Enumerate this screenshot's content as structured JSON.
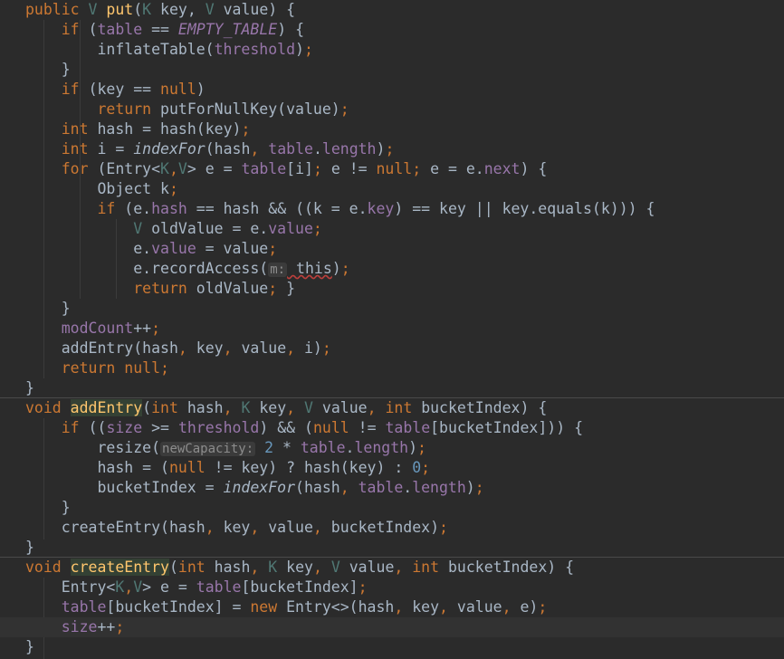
{
  "editor": {
    "lines": [
      [
        [
          "kw",
          "public "
        ],
        [
          "tp",
          "V "
        ],
        [
          "fn",
          "put"
        ],
        [
          "",
          "("
        ],
        [
          "tp",
          "K "
        ],
        [
          "",
          "key, "
        ],
        [
          "tp",
          "V "
        ],
        [
          "",
          "value) {"
        ]
      ],
      [
        [
          "",
          "    "
        ],
        [
          "kw",
          "if "
        ],
        [
          "",
          "("
        ],
        [
          "fld",
          "table"
        ],
        [
          "",
          " == "
        ],
        [
          "cst",
          "EMPTY_TABLE"
        ],
        [
          "",
          ") {"
        ]
      ],
      [
        [
          "",
          "        inflateTable("
        ],
        [
          "fld",
          "threshold"
        ],
        [
          "",
          ")"
        ],
        [
          "kw",
          ";"
        ]
      ],
      [
        [
          "",
          "    }"
        ]
      ],
      [
        [
          "",
          "    "
        ],
        [
          "kw",
          "if "
        ],
        [
          "",
          "(key == "
        ],
        [
          "kw",
          "null"
        ],
        [
          "",
          ")"
        ]
      ],
      [
        [
          "",
          "        "
        ],
        [
          "kw",
          "return "
        ],
        [
          "",
          "putForNullKey(value)"
        ],
        [
          "kw",
          ";"
        ]
      ],
      [
        [
          "",
          "    "
        ],
        [
          "kw",
          "int "
        ],
        [
          "",
          "hash = hash(key)"
        ],
        [
          "kw",
          ";"
        ]
      ],
      [
        [
          "",
          "    "
        ],
        [
          "kw",
          "int "
        ],
        [
          "",
          "i = "
        ],
        [
          "it",
          "indexFor"
        ],
        [
          "",
          "(hash"
        ],
        [
          "kw",
          ", "
        ],
        [
          "fld",
          "table"
        ],
        [
          "",
          "."
        ],
        [
          "fld",
          "length"
        ],
        [
          "",
          ")"
        ],
        [
          "kw",
          ";"
        ]
      ],
      [
        [
          "",
          "    "
        ],
        [
          "kw",
          "for "
        ],
        [
          "",
          "(Entry<"
        ],
        [
          "tp",
          "K"
        ],
        [
          "kw",
          ","
        ],
        [
          "tp",
          "V"
        ],
        [
          "",
          "> e = "
        ],
        [
          "fld",
          "table"
        ],
        [
          "",
          "[i]"
        ],
        [
          "kw",
          "; "
        ],
        [
          "",
          "e != "
        ],
        [
          "kw",
          "null"
        ],
        [
          "kw",
          "; "
        ],
        [
          "",
          "e = e."
        ],
        [
          "fld",
          "next"
        ],
        [
          "",
          ") {"
        ]
      ],
      [
        [
          "",
          "        Object k"
        ],
        [
          "kw",
          ";"
        ]
      ],
      [
        [
          "",
          "        "
        ],
        [
          "kw",
          "if "
        ],
        [
          "",
          "(e."
        ],
        [
          "fld",
          "hash"
        ],
        [
          "",
          " == hash && ((k = e."
        ],
        [
          "fld",
          "key"
        ],
        [
          "",
          ") == key || key.equals(k))) {"
        ]
      ],
      [
        [
          "",
          "            "
        ],
        [
          "tp",
          "V "
        ],
        [
          "",
          "oldValue = e."
        ],
        [
          "fld",
          "value"
        ],
        [
          "kw",
          ";"
        ]
      ],
      [
        [
          "",
          "            e."
        ],
        [
          "fld",
          "value"
        ],
        [
          "",
          " = value"
        ],
        [
          "kw",
          ";"
        ]
      ],
      [
        [
          "",
          "            e.recordAccess("
        ],
        [
          "hint",
          "m:"
        ],
        [
          "squig",
          " this"
        ],
        [
          "",
          ")"
        ],
        [
          "kw",
          ";"
        ]
      ],
      [
        [
          "",
          "            "
        ],
        [
          "kw",
          "return "
        ],
        [
          "",
          "oldValue"
        ],
        [
          "kw",
          "; "
        ],
        [
          "",
          "}"
        ]
      ],
      [
        [
          "",
          "    }"
        ]
      ],
      [
        [
          "",
          "    "
        ],
        [
          "fld",
          "modCount"
        ],
        [
          "",
          "++"
        ],
        [
          "kw",
          ";"
        ]
      ],
      [
        [
          "",
          "    addEntry(hash"
        ],
        [
          "kw",
          ", "
        ],
        [
          "",
          "key"
        ],
        [
          "kw",
          ", "
        ],
        [
          "",
          "value"
        ],
        [
          "kw",
          ", "
        ],
        [
          "",
          "i)"
        ],
        [
          "kw",
          ";"
        ]
      ],
      [
        [
          "",
          "    "
        ],
        [
          "kw",
          "return null;"
        ]
      ],
      [
        [
          "",
          "}"
        ]
      ],
      [
        [
          "kw",
          "void "
        ],
        [
          "fn hl",
          "addEntry"
        ],
        [
          "",
          "("
        ],
        [
          "kw",
          "int "
        ],
        [
          "",
          "hash"
        ],
        [
          "kw",
          ", "
        ],
        [
          "tp",
          "K "
        ],
        [
          "",
          "key"
        ],
        [
          "kw",
          ", "
        ],
        [
          "tp",
          "V "
        ],
        [
          "",
          "value"
        ],
        [
          "kw",
          ", int "
        ],
        [
          "",
          "bucketIndex) {"
        ]
      ],
      [
        [
          "",
          "    "
        ],
        [
          "kw",
          "if "
        ],
        [
          "",
          "(("
        ],
        [
          "fld",
          "size"
        ],
        [
          "",
          " >= "
        ],
        [
          "fld",
          "threshold"
        ],
        [
          "",
          ") && ("
        ],
        [
          "kw",
          "null"
        ],
        [
          "",
          " != "
        ],
        [
          "fld",
          "table"
        ],
        [
          "",
          "[bucketIndex])) {"
        ]
      ],
      [
        [
          "",
          "        resize("
        ],
        [
          "hint",
          "newCapacity:"
        ],
        [
          "",
          ""
        ],
        [
          "num",
          " 2"
        ],
        [
          "",
          " * "
        ],
        [
          "fld",
          "table"
        ],
        [
          "",
          "."
        ],
        [
          "fld",
          "length"
        ],
        [
          "",
          ")"
        ],
        [
          "kw",
          ";"
        ]
      ],
      [
        [
          "",
          "        hash = ("
        ],
        [
          "kw",
          "null"
        ],
        [
          "",
          " != key) ? hash(key) : "
        ],
        [
          "num",
          "0"
        ],
        [
          "kw",
          ";"
        ]
      ],
      [
        [
          "",
          "        bucketIndex = "
        ],
        [
          "it",
          "indexFor"
        ],
        [
          "",
          "(hash"
        ],
        [
          "kw",
          ", "
        ],
        [
          "fld",
          "table"
        ],
        [
          "",
          "."
        ],
        [
          "fld",
          "length"
        ],
        [
          "",
          ")"
        ],
        [
          "kw",
          ";"
        ]
      ],
      [
        [
          "",
          "    }"
        ]
      ],
      [
        [
          "",
          "    createEntry(hash"
        ],
        [
          "kw",
          ", "
        ],
        [
          "",
          "key"
        ],
        [
          "kw",
          ", "
        ],
        [
          "",
          "value"
        ],
        [
          "kw",
          ", "
        ],
        [
          "",
          "bucketIndex)"
        ],
        [
          "kw",
          ";"
        ]
      ],
      [
        [
          "",
          "}"
        ]
      ],
      [
        [
          "kw",
          "void "
        ],
        [
          "fn hl",
          "createEntry"
        ],
        [
          "",
          "("
        ],
        [
          "kw",
          "int "
        ],
        [
          "",
          "hash"
        ],
        [
          "kw",
          ", "
        ],
        [
          "tp",
          "K "
        ],
        [
          "",
          "key"
        ],
        [
          "kw",
          ", "
        ],
        [
          "tp",
          "V "
        ],
        [
          "",
          "value"
        ],
        [
          "kw",
          ", int "
        ],
        [
          "",
          "bucketIndex) {"
        ]
      ],
      [
        [
          "",
          "    Entry<"
        ],
        [
          "tp",
          "K"
        ],
        [
          "kw",
          ","
        ],
        [
          "tp",
          "V"
        ],
        [
          "",
          "> e = "
        ],
        [
          "fld",
          "table"
        ],
        [
          "",
          "[bucketIndex]"
        ],
        [
          "kw",
          ";"
        ]
      ],
      [
        [
          "",
          "    "
        ],
        [
          "fld",
          "table"
        ],
        [
          "",
          "[bucketIndex] = "
        ],
        [
          "kw",
          "new "
        ],
        [
          "",
          "Entry<>(hash"
        ],
        [
          "kw",
          ", "
        ],
        [
          "",
          "key"
        ],
        [
          "kw",
          ", "
        ],
        [
          "",
          "value"
        ],
        [
          "kw",
          ", "
        ],
        [
          "",
          "e)"
        ],
        [
          "kw",
          ";"
        ]
      ],
      [
        [
          "",
          "    "
        ],
        [
          "fld",
          "size"
        ],
        [
          "",
          "++"
        ],
        [
          "kw",
          ";"
        ]
      ],
      [
        [
          "",
          "}"
        ]
      ]
    ],
    "current_line": 31,
    "separators_after": [
      19,
      27
    ],
    "colors": {
      "background": "#2b2b2b",
      "keyword": "#cc7832",
      "field": "#9876aa",
      "type_param": "#507874",
      "method_decl": "#ffc66d",
      "number": "#6897bb",
      "default_text": "#a9b7c6"
    }
  }
}
